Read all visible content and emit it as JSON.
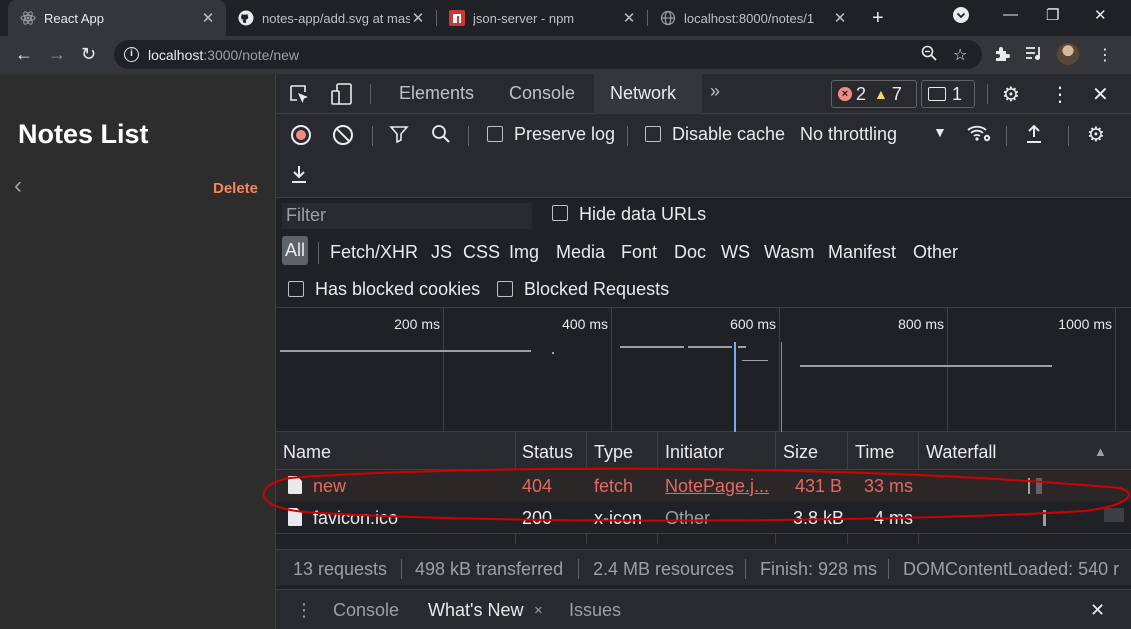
{
  "browser": {
    "tabs": [
      {
        "title": "React App",
        "active": true
      },
      {
        "title": "notes-app/add.svg at mast",
        "active": false
      },
      {
        "title": "json-server - npm",
        "active": false
      },
      {
        "title": "localhost:8000/notes/1",
        "active": false
      }
    ],
    "new_tab": "+",
    "address": {
      "host": "localhost",
      "path": ":3000/note/new"
    }
  },
  "app": {
    "title": "Notes List",
    "back": "‹",
    "delete_label": "Delete"
  },
  "devtools": {
    "panels": [
      "Elements",
      "Console",
      "Network"
    ],
    "more": "»",
    "errors": "2",
    "warnings": "7",
    "messages": "1",
    "network": {
      "preserve_log": "Preserve log",
      "disable_cache": "Disable cache",
      "throttling": "No throttling",
      "filter_placeholder": "Filter",
      "hide_data_urls": "Hide data URLs",
      "types": [
        "All",
        "Fetch/XHR",
        "JS",
        "CSS",
        "Img",
        "Media",
        "Font",
        "Doc",
        "WS",
        "Wasm",
        "Manifest",
        "Other"
      ],
      "has_blocked_cookies": "Has blocked cookies",
      "blocked_requests": "Blocked Requests",
      "timeline_labels": [
        "200 ms",
        "400 ms",
        "600 ms",
        "800 ms",
        "1000 ms"
      ],
      "columns": [
        "Name",
        "Status",
        "Type",
        "Initiator",
        "Size",
        "Time",
        "Waterfall"
      ],
      "sort_indicator": "▲",
      "rows": [
        {
          "name": "new",
          "status": "404",
          "type": "fetch",
          "initiator": "NotePage.j...",
          "size": "431 B",
          "time": "33 ms",
          "error": true
        },
        {
          "name": "favicon.ico",
          "status": "200",
          "type": "x-icon",
          "initiator": "Other",
          "size": "3.8 kB",
          "time": "4 ms",
          "error": false
        }
      ],
      "summary": {
        "requests": "13 requests",
        "transferred": "498 kB transferred",
        "resources": "2.4 MB resources",
        "finish": "Finish: 928 ms",
        "dcl": "DOMContentLoaded: 540 r"
      }
    },
    "drawer": {
      "tabs": [
        "Console",
        "What's New",
        "Issues"
      ],
      "active_close": "×",
      "close": "✕"
    }
  },
  "colors": {
    "error_text": "#e46962",
    "annotation": "#d40000",
    "delete": "#f68657"
  }
}
